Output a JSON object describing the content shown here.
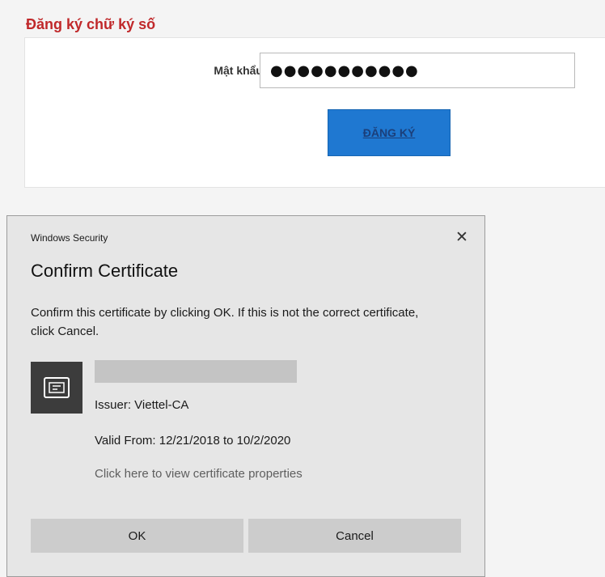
{
  "page": {
    "heading": "Đăng ký chữ ký số",
    "password_label": "Mật khẩu",
    "password_value": "●●●●●●●●●●●",
    "register_label": "ĐĂNG KÝ"
  },
  "dialog": {
    "caption": "Windows Security",
    "close_glyph": "✕",
    "title": "Confirm Certificate",
    "message": "Confirm this certificate by clicking OK. If this is not the correct certificate, click Cancel.",
    "certificate": {
      "issuer": "Issuer: Viettel-CA",
      "valid": "Valid From: 12/21/2018 to 10/2/2020",
      "properties_link": "Click here to view certificate properties",
      "icon": "certificate-icon"
    },
    "ok_label": "OK",
    "cancel_label": "Cancel"
  },
  "colors": {
    "heading": "#c0282a",
    "register_button": "#1f78d1",
    "dialog_background": "#e6e6e6",
    "dialog_button": "#cccccc",
    "icon_tile": "#3c3c3c"
  }
}
